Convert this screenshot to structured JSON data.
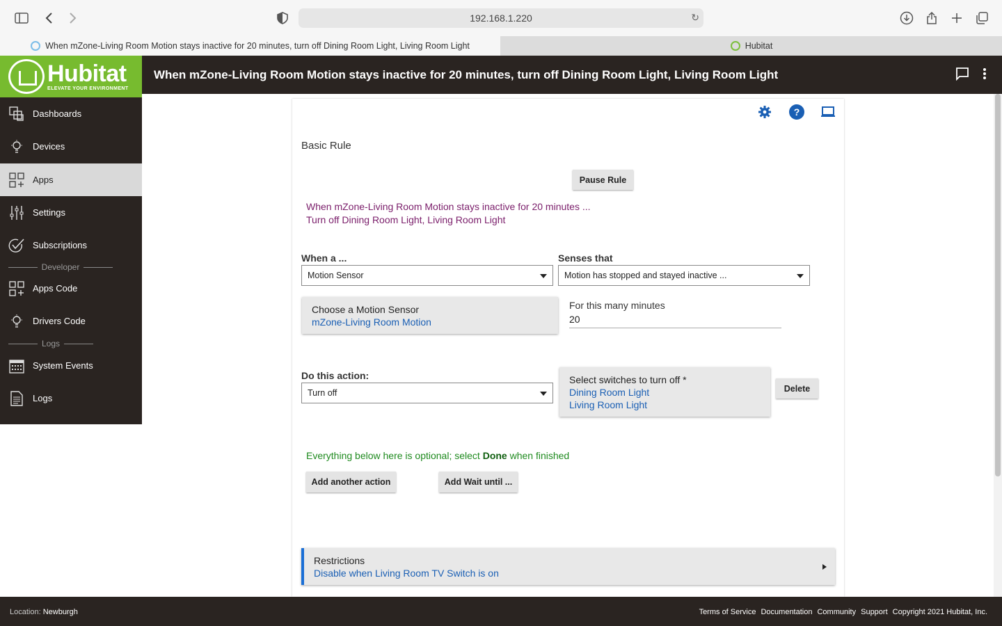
{
  "browser": {
    "url": "192.168.1.220",
    "tabs": [
      {
        "title": "When mZone-Living Room Motion stays inactive for 20 minutes, turn off Dining Room Light, Living Room Light"
      },
      {
        "title": "Hubitat"
      }
    ],
    "icons": [
      "sidebar-toggle-icon",
      "back-icon",
      "forward-icon",
      "shield-icon",
      "reload-icon",
      "download-icon",
      "share-icon",
      "new-tab-icon",
      "tabs-overview-icon"
    ]
  },
  "header": {
    "logo_name": "Hubitat",
    "logo_tagline": "ELEVATE YOUR ENVIRONMENT",
    "title": "When mZone-Living Room Motion stays inactive for 20 minutes, turn off Dining Room Light, Living Room Light"
  },
  "sidebar": {
    "items": [
      {
        "label": "Dashboards",
        "icon": "dashboards-icon"
      },
      {
        "label": "Devices",
        "icon": "lightbulb-icon"
      },
      {
        "label": "Apps",
        "icon": "apps-icon",
        "active": true
      },
      {
        "label": "Settings",
        "icon": "sliders-icon"
      },
      {
        "label": "Subscriptions",
        "icon": "checkmark-icon"
      },
      {
        "label": "Apps Code",
        "icon": "apps-code-icon"
      },
      {
        "label": "Drivers Code",
        "icon": "lightbulb-icon"
      },
      {
        "label": "System Events",
        "icon": "calendar-icon"
      },
      {
        "label": "Logs",
        "icon": "document-icon"
      }
    ],
    "separators": [
      "Developer",
      "Logs"
    ]
  },
  "rule": {
    "section_title": "Basic Rule",
    "pause_label": "Pause Rule",
    "description_line1": "When mZone-Living Room Motion stays inactive for 20 minutes ...",
    "description_line2": "Turn off Dining Room Light, Living Room Light",
    "when_label": "When a ...",
    "when_value": "Motion Sensor",
    "senses_label": "Senses that",
    "senses_value": "Motion has stopped and stayed inactive ...",
    "sensor_picker_title": "Choose a Motion Sensor",
    "sensor_picker_value": "mZone-Living Room Motion",
    "minutes_label": "For this many minutes",
    "minutes_value": "20",
    "action_label": "Do this action:",
    "action_value": "Turn off",
    "switches_title": "Select switches to turn off *",
    "switches": [
      "Dining Room Light",
      "Living Room Light"
    ],
    "delete_label": "Delete",
    "optional_prefix": "Everything below here is optional; select ",
    "optional_done": "Done",
    "optional_suffix": " when finished",
    "add_action_label": "Add another action",
    "add_wait_label": "Add Wait until ...",
    "restrictions_title": "Restrictions",
    "restrictions_value": "Disable when Living Room TV Switch is on"
  },
  "footer": {
    "location_label": "Location:",
    "location_value": "Newburgh",
    "links": [
      "Terms of Service",
      "Documentation",
      "Community",
      "Support",
      "Copyright 2021 Hubitat, Inc."
    ]
  },
  "colors": {
    "brand_green": "#77bb2f",
    "header_dark": "#2a2421",
    "link_blue": "#1a5fb4",
    "description_purple": "#7a1d6a",
    "optional_green": "#1e8a1e"
  }
}
